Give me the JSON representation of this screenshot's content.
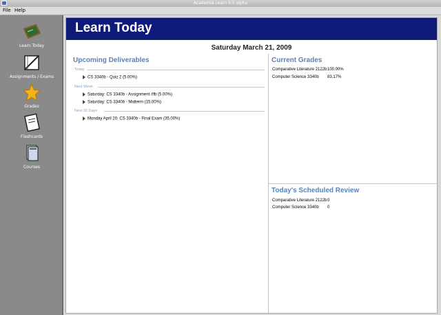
{
  "window": {
    "title": "Academia Learn 0.5 alpha"
  },
  "menu": {
    "file": "File",
    "help": "Help"
  },
  "sidebar": {
    "items": [
      {
        "label": "Learn Today",
        "icon": "chalkboard-icon"
      },
      {
        "label": "Assignments / Exams",
        "icon": "pencil-ruler-icon"
      },
      {
        "label": "Grades",
        "icon": "star-icon"
      },
      {
        "label": "Flashcards",
        "icon": "flashcard-icon"
      },
      {
        "label": "Courses",
        "icon": "books-icon"
      }
    ]
  },
  "banner": {
    "title": "Learn Today"
  },
  "date": "Saturday March 21, 2009",
  "deliverables": {
    "title": "Upcoming Deliverables",
    "groups": [
      {
        "label": "Today",
        "items": [
          "CS 3340b - Quiz 2 (5.00%)"
        ]
      },
      {
        "label": "Next Week",
        "items": [
          "Saturday: CS 3340b - Assignment #fb (5.00%)",
          "Saturday: CS 3340b - Midterm (15.00%)"
        ]
      },
      {
        "label": "Next 30 Days",
        "items": [
          "Monday April 20: CS 3340b - Final Exam (35.00%)"
        ]
      }
    ]
  },
  "grades": {
    "title": "Current Grades",
    "rows": [
      {
        "course": "Comparative Literature 2122b",
        "value": "100.00%"
      },
      {
        "course": "Computer Science 3340b",
        "value": "83.17%"
      }
    ]
  },
  "review": {
    "title": "Today's Scheduled Review",
    "rows": [
      {
        "course": "Comparative Literature 2122b",
        "value": "0"
      },
      {
        "course": "Computer Science 3340b",
        "value": "0"
      }
    ]
  }
}
